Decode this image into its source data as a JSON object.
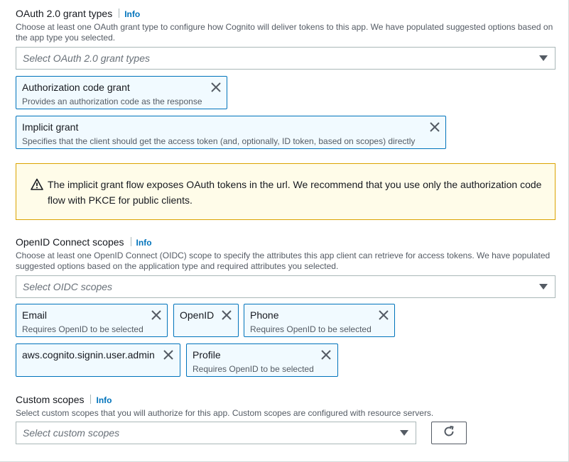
{
  "oauth": {
    "label": "OAuth 2.0 grant types",
    "info": "Info",
    "description": "Choose at least one OAuth grant type to configure how Cognito will deliver tokens to this app. We have populated suggested options based on the app type you selected.",
    "placeholder": "Select OAuth 2.0 grant types",
    "tokens": [
      {
        "title": "Authorization code grant",
        "subtitle": "Provides an authorization code as the response"
      },
      {
        "title": "Implicit grant",
        "subtitle": "Specifies that the client should get the access token (and, optionally, ID token, based on scopes) directly"
      }
    ]
  },
  "alert": {
    "icon": "warning-icon",
    "text": "The implicit grant flow exposes OAuth tokens in the url. We recommend that you use only the authorization code flow with PKCE for public clients."
  },
  "oidc": {
    "label": "OpenID Connect scopes",
    "info": "Info",
    "description": "Choose at least one OpenID Connect (OIDC) scope to specify the attributes this app client can retrieve for access tokens. We have populated suggested options based on the application type and required attributes you selected.",
    "placeholder": "Select OIDC scopes",
    "tokens": [
      {
        "title": "Email",
        "subtitle": "Requires OpenID to be selected"
      },
      {
        "title": "OpenID",
        "subtitle": ""
      },
      {
        "title": "Phone",
        "subtitle": "Requires OpenID to be selected"
      },
      {
        "title": "aws.cognito.signin.user.admin",
        "subtitle": ""
      },
      {
        "title": "Profile",
        "subtitle": "Requires OpenID to be selected"
      }
    ]
  },
  "custom": {
    "label": "Custom scopes",
    "info": "Info",
    "description": "Select custom scopes that you will authorize for this app. Custom scopes are configured with resource servers.",
    "placeholder": "Select custom scopes",
    "refresh_icon": "refresh-icon"
  },
  "colors": {
    "link": "#0073bb",
    "token_border": "#0073bb",
    "token_bg": "#f1faff",
    "warning_border": "#dba300",
    "warning_bg": "#fffce9"
  }
}
